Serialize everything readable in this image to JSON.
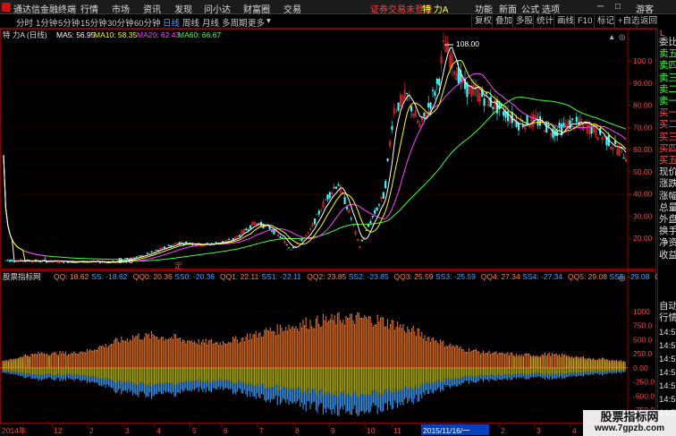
{
  "app": {
    "title": "通达信金融终端",
    "menus": [
      "行情",
      "市场",
      "资讯",
      "发现",
      "问小达",
      "财富圈",
      "交易"
    ],
    "trade_status": "证券交易未登录",
    "stock_name": "特 力A",
    "right_menus": [
      "功能",
      "新面",
      "公式",
      "选项"
    ],
    "guest": "游客"
  },
  "period_bar": {
    "items": [
      "分时",
      "1分钟",
      "5分钟",
      "15分钟",
      "30分钟",
      "60分钟",
      "日线",
      "周线",
      "月线",
      "多周期",
      "更多"
    ],
    "active": "日线",
    "tools": [
      "复权",
      "叠加",
      "多股",
      "统计",
      "画线",
      "F10",
      "标记",
      "+自选",
      "返回"
    ]
  },
  "main_chart": {
    "header": {
      "stock": "特 力A (日线)",
      "ma": [
        {
          "label": "MA5: 56.95",
          "color": "#ffffff"
        },
        {
          "label": "MA10: 58.35",
          "color": "#ffff00"
        },
        {
          "label": "MA20: 62.43",
          "color": "#ff40ff"
        },
        {
          "label": "MA60: 66.67",
          "color": "#40ff40"
        }
      ]
    },
    "y_ticks": [
      "100.0",
      "90.00",
      "80.00",
      "70.00",
      "60.00",
      "50.00",
      "40.00",
      "30.00",
      "20.00"
    ],
    "high_label": "108.00",
    "low_label": "8.70",
    "marker_label": "定"
  },
  "indicator": {
    "name": "股票指标网",
    "items": [
      {
        "label": "QQ: 18.62",
        "color": "#ff8040"
      },
      {
        "label": "SS: -18.62",
        "color": "#40a0ff"
      },
      {
        "label": "QQ0: 20.36",
        "color": "#ff8040"
      },
      {
        "label": "SS0: -20.36",
        "color": "#40a0ff"
      },
      {
        "label": "QQ1: 22.11",
        "color": "#ff8040"
      },
      {
        "label": "SS1: -22.11",
        "color": "#40a0ff"
      },
      {
        "label": "QQ2: 23.85",
        "color": "#ff8040"
      },
      {
        "label": "SS2: -23.85",
        "color": "#40a0ff"
      },
      {
        "label": "QQ3: 25.59",
        "color": "#ff8040"
      },
      {
        "label": "SS3: -25.59",
        "color": "#40a0ff"
      },
      {
        "label": "QQ4: 27.34",
        "color": "#ff8040"
      },
      {
        "label": "SS4: -27.34",
        "color": "#40a0ff"
      },
      {
        "label": "QQ5: 29.08",
        "color": "#ff8040"
      },
      {
        "label": "SS5: -29.08",
        "color": "#40a0ff"
      },
      {
        "label": "QQ6: 30.8",
        "color": "#ff8040"
      }
    ],
    "y_ticks": [
      "1000",
      "750.0",
      "500.0",
      "250.0",
      "0.00",
      "-250.0",
      "-500.0",
      "-750.0"
    ]
  },
  "time_axis": {
    "labels": [
      "2014年",
      "12",
      "2",
      "3",
      "4",
      "5",
      "6",
      "7",
      "8",
      "9",
      "10",
      "11",
      "2015/11/16/一",
      "2",
      "3",
      "4",
      "5"
    ]
  },
  "side_panel": {
    "top_badge": "L",
    "items": [
      "委比",
      "卖五",
      "卖四",
      "卖三",
      "卖二",
      "卖一",
      "买一",
      "买二",
      "买三",
      "买四",
      "买五",
      "现价",
      "涨跌",
      "涨幅",
      "总量",
      "外盘",
      "换手",
      "净资",
      "收益"
    ],
    "lower_items": [
      "自动",
      "行情"
    ],
    "times": [
      "14:5",
      "14:5",
      "14:5",
      "14:5",
      "14:5",
      "14:5",
      "14:5"
    ]
  },
  "watermark": {
    "title": "股票指标网",
    "url": "www.7gpzb.com"
  }
}
